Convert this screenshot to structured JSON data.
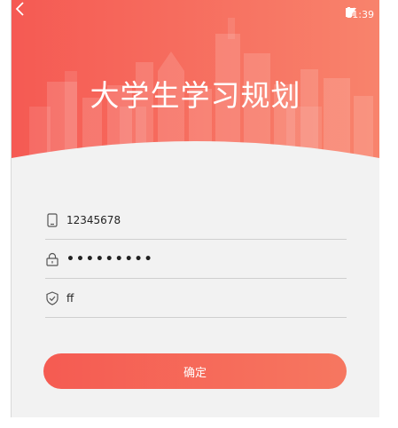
{
  "status_bar": {
    "time": "11:39"
  },
  "header": {
    "title": "大学生学习规划"
  },
  "form": {
    "phone_value": "12345678",
    "password_value": "•••••••••",
    "code_value": "ff"
  },
  "confirm_label": "确定",
  "colors": {
    "accent": "#f65c54",
    "accent_light": "#f8806a",
    "background": "#f2f2f2"
  }
}
